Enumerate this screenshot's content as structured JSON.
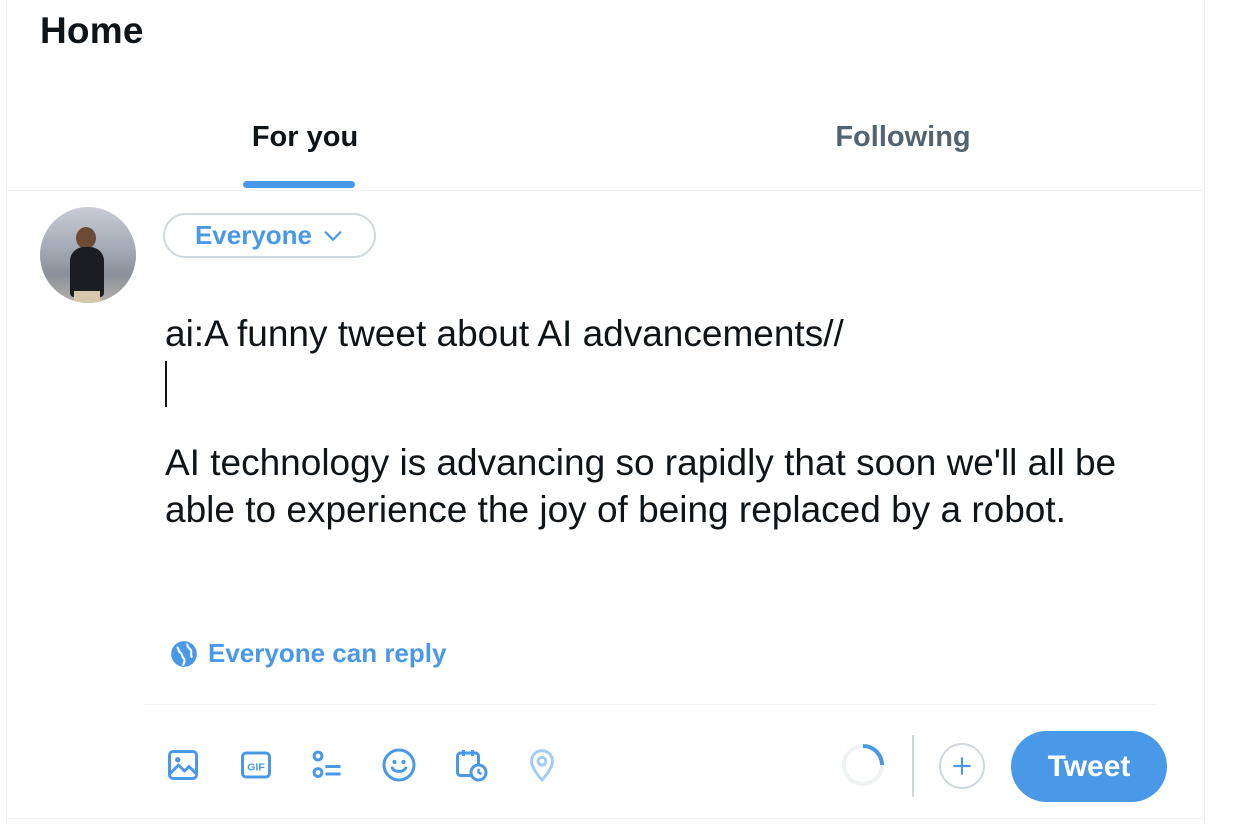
{
  "header": {
    "title": "Home"
  },
  "tabs": [
    {
      "label": "For you",
      "active": true
    },
    {
      "label": "Following",
      "active": false
    }
  ],
  "composer": {
    "audience_label": "Everyone",
    "prompt_line": "ai:A funny tweet about AI advancements//",
    "body_text": "AI technology is advancing so rapidly that soon we'll all be able to experience the joy of being replaced by a robot.",
    "reply_setting_label": "Everyone can reply",
    "toolbar_icons": [
      "image-icon",
      "gif-icon",
      "poll-icon",
      "emoji-icon",
      "schedule-icon",
      "location-icon"
    ],
    "tweet_button_label": "Tweet"
  },
  "colors": {
    "accent": "#4a99e9",
    "text": "#0f1419",
    "muted": "#536471",
    "border": "#cfd9de"
  }
}
